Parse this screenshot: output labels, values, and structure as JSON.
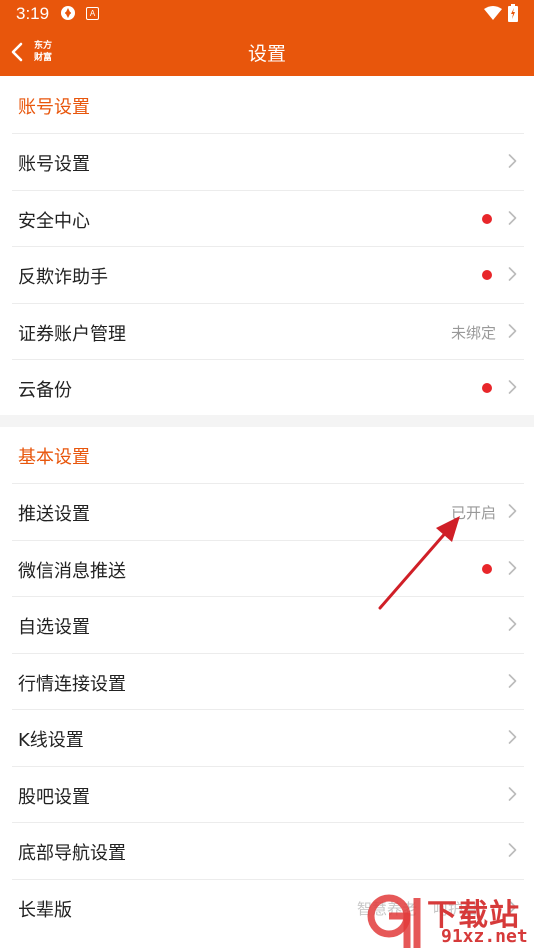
{
  "status_bar": {
    "time": "3:19",
    "badge": "A"
  },
  "header": {
    "logo_line1": "东方",
    "logo_line2": "财富",
    "title": "设置"
  },
  "sections": [
    {
      "title": "账号设置",
      "items": [
        {
          "label": "账号设置",
          "status": "",
          "dot": false
        },
        {
          "label": "安全中心",
          "status": "",
          "dot": true
        },
        {
          "label": "反欺诈助手",
          "status": "",
          "dot": true
        },
        {
          "label": "证券账户管理",
          "status": "未绑定",
          "dot": false
        },
        {
          "label": "云备份",
          "status": "",
          "dot": true
        }
      ]
    },
    {
      "title": "基本设置",
      "items": [
        {
          "label": "推送设置",
          "status": "已开启",
          "dot": false
        },
        {
          "label": "微信消息推送",
          "status": "",
          "dot": true
        },
        {
          "label": "自选设置",
          "status": "",
          "dot": false
        },
        {
          "label": "行情连接设置",
          "status": "",
          "dot": false
        },
        {
          "label": "K线设置",
          "status": "",
          "dot": false
        },
        {
          "label": "股吧设置",
          "status": "",
          "dot": false
        },
        {
          "label": "底部导航设置",
          "status": "",
          "dot": false
        },
        {
          "label": "长辈版",
          "status": "",
          "dot": false
        }
      ]
    }
  ],
  "watermark": {
    "text_left": "智慧养老",
    "text_mid": "呵护目",
    "brand": "下载站",
    "url": "91xz.net"
  },
  "colors": {
    "accent": "#e8560c",
    "dot": "#e8262a",
    "annotation_arrow": "#d01f27"
  }
}
